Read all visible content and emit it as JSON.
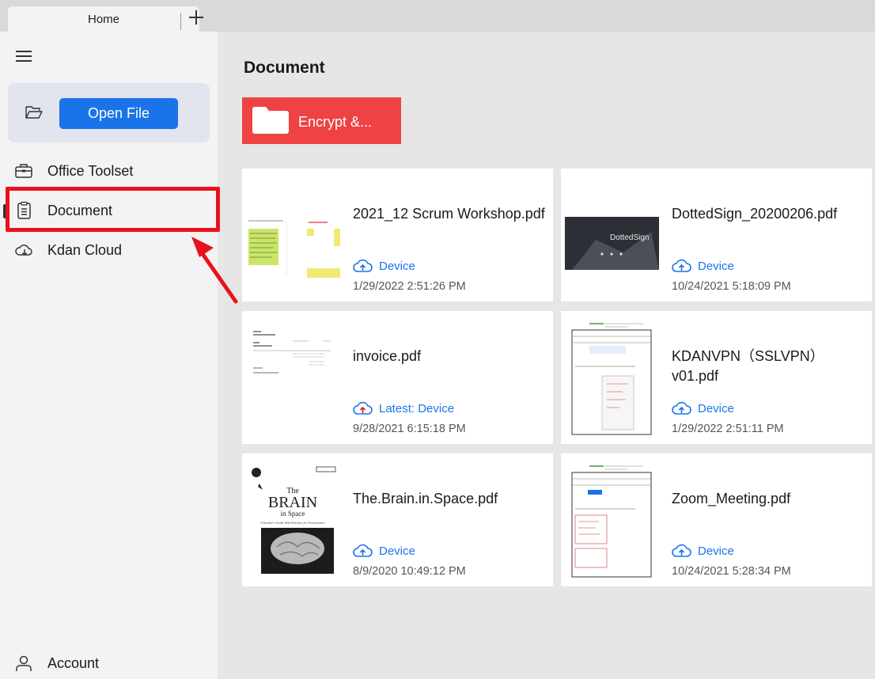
{
  "tabs": [
    {
      "label": "Home"
    }
  ],
  "sidebar": {
    "open_file_label": "Open File",
    "items": [
      {
        "label": "Office Toolset"
      },
      {
        "label": "Document"
      },
      {
        "label": "Kdan Cloud"
      }
    ],
    "account_label": "Account"
  },
  "main": {
    "title": "Document",
    "encrypt_tile_label": "Encrypt &...",
    "files": [
      {
        "name": "2021_12 Scrum Workshop.pdf",
        "storage": "Device",
        "date": "1/29/2022 2:51:26 PM"
      },
      {
        "name": "DottedSign_20200206.pdf",
        "storage": "Device",
        "date": "10/24/2021 5:18:09 PM"
      },
      {
        "name": "invoice.pdf",
        "storage": "Latest: Device",
        "date": "9/28/2021 6:15:18 PM"
      },
      {
        "name": "KDANVPN（SSLVPN）v01.pdf",
        "storage": "Device",
        "date": "1/29/2022 2:51:11 PM"
      },
      {
        "name": "The.Brain.in.Space.pdf",
        "storage": "Device",
        "date": "8/9/2020 10:49:12 PM"
      },
      {
        "name": "Zoom_Meeting.pdf",
        "storage": "Device",
        "date": "10/24/2021 5:28:34 PM"
      }
    ]
  },
  "thumbnails": {
    "dotted_sign_text": "DottedSign",
    "brain_title": "The",
    "brain_big": "BRAIN",
    "brain_sub": "in Space",
    "brain_caption": "A Teacher's Guide With Activities for Neuroscience"
  },
  "colors": {
    "accent": "#1a73e8",
    "encrypt_tile": "#ee4243",
    "annotation_red": "#e8121b"
  }
}
